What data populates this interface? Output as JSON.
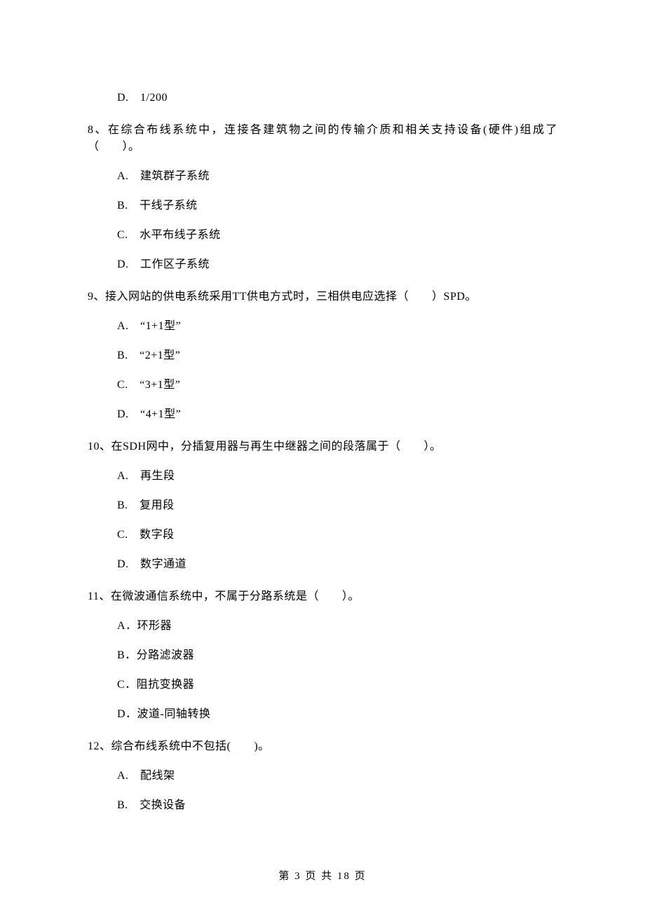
{
  "orphan_option": "D.　1/200",
  "questions": [
    {
      "stem": "8、在综合布线系统中，连接各建筑物之间的传输介质和相关支持设备(硬件)组成了（　　）。",
      "options": [
        "A.　建筑群子系统",
        "B.　干线子系统",
        "C.　水平布线子系统",
        "D.　工作区子系统"
      ]
    },
    {
      "stem": "9、接入网站的供电系统采用TT供电方式时，三相供电应选择（　　）SPD。",
      "options": [
        "A.　“1+1型”",
        "B.　“2+1型”",
        "C.　“3+1型”",
        "D.　“4+1型”"
      ]
    },
    {
      "stem": "10、在SDH网中，分插复用器与再生中继器之间的段落属于（　　）。",
      "options": [
        "A.　再生段",
        "B.　复用段",
        "C.　数字段",
        "D.　数字通道"
      ]
    },
    {
      "stem": "11、在微波通信系统中，不属于分路系统是（　　）。",
      "options": [
        "A．环形器",
        "B．分路滤波器",
        "C．阻抗变换器",
        "D．波道-同轴转换"
      ]
    },
    {
      "stem": "12、综合布线系统中不包括(　　)。",
      "options": [
        "A.　配线架",
        "B.　交换设备"
      ]
    }
  ],
  "footer": "第 3 页 共 18 页"
}
